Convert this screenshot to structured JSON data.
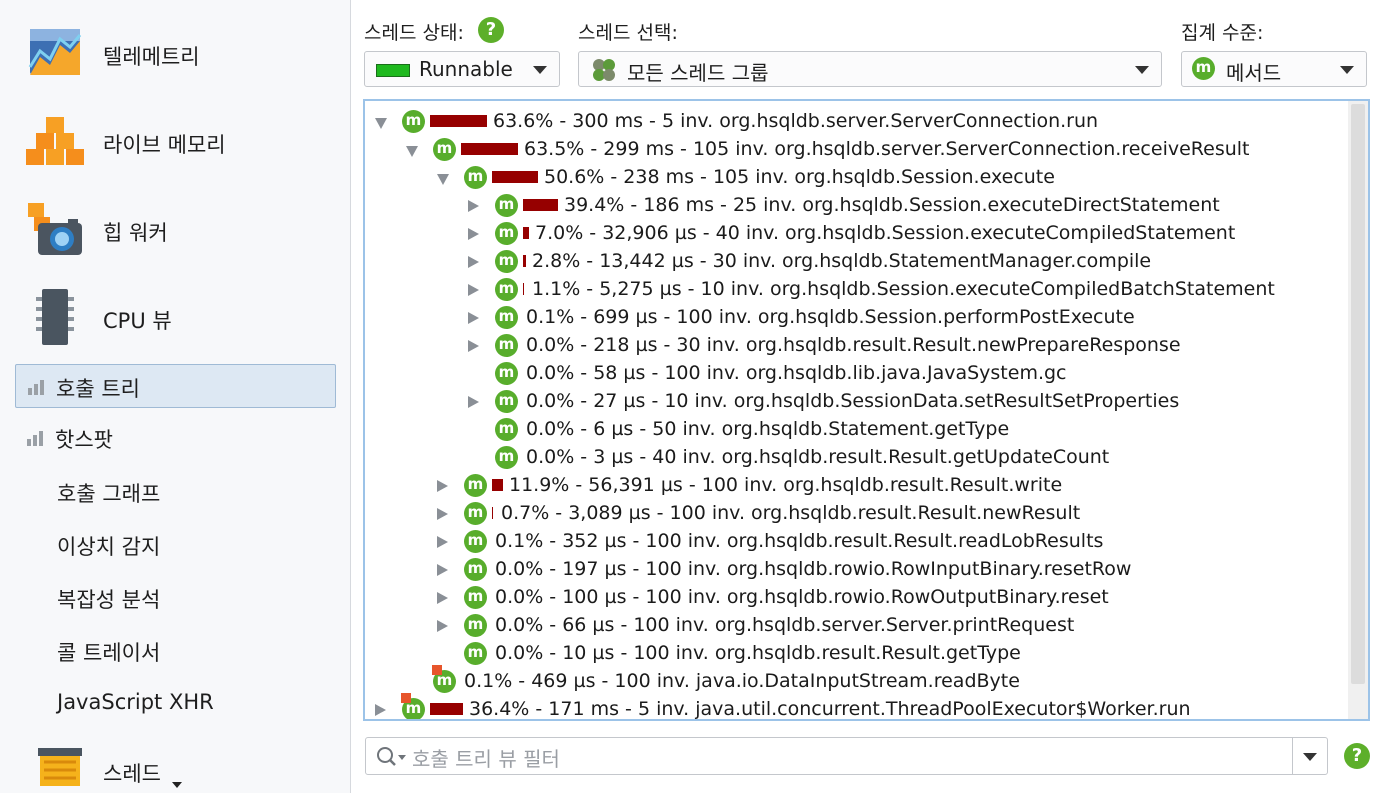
{
  "sidebar": {
    "big_items": [
      {
        "label": "텔레메트리",
        "icon": "telemetry-icon"
      },
      {
        "label": "라이브 메모리",
        "icon": "live-memory-icon"
      },
      {
        "label": "힙 워커",
        "icon": "heap-walker-icon"
      },
      {
        "label": "CPU 뷰",
        "icon": "cpu-views-icon"
      }
    ],
    "sub_items": [
      {
        "label": "호출 트리",
        "selected": true
      },
      {
        "label": "핫스팟",
        "selected": false
      }
    ],
    "leaf_items": [
      "호출 그래프",
      "이상치 감지",
      "복잡성 분석",
      "콜 트레이서",
      "JavaScript XHR"
    ],
    "threads_label": "스레드"
  },
  "toolbar": {
    "thread_status_label": "스레드 상태:",
    "thread_status_value": "Runnable",
    "thread_status_color": "#1fb91f",
    "thread_select_label": "스레드 선택:",
    "thread_select_value": "모든 스레드 그룹",
    "aggregation_label": "집계 수준:",
    "aggregation_value": "메서드",
    "help_glyph": "?"
  },
  "tree": {
    "accent_bar_color": "#960000",
    "node_icon_letter": "m",
    "rows": [
      {
        "depth": 0,
        "toggle": "open",
        "bar_pct": 63.6,
        "flag": false,
        "text": "63.6% - 300 ms - 5 inv. org.hsqldb.server.ServerConnection.run"
      },
      {
        "depth": 1,
        "toggle": "open",
        "bar_pct": 63.5,
        "flag": false,
        "text": "63.5% - 299 ms - 105 inv. org.hsqldb.server.ServerConnection.receiveResult"
      },
      {
        "depth": 2,
        "toggle": "open",
        "bar_pct": 50.6,
        "flag": false,
        "text": "50.6% - 238 ms - 105 inv. org.hsqldb.Session.execute"
      },
      {
        "depth": 3,
        "toggle": "closed",
        "bar_pct": 39.4,
        "flag": false,
        "text": "39.4% - 186 ms - 25 inv. org.hsqldb.Session.executeDirectStatement"
      },
      {
        "depth": 3,
        "toggle": "closed",
        "bar_pct": 7.0,
        "flag": false,
        "text": "7.0% - 32,906 µs - 40 inv. org.hsqldb.Session.executeCompiledStatement"
      },
      {
        "depth": 3,
        "toggle": "closed",
        "bar_pct": 2.8,
        "flag": false,
        "text": "2.8% - 13,442 µs - 30 inv. org.hsqldb.StatementManager.compile"
      },
      {
        "depth": 3,
        "toggle": "closed",
        "bar_pct": 1.1,
        "flag": false,
        "text": "1.1% - 5,275 µs - 10 inv. org.hsqldb.Session.executeCompiledBatchStatement"
      },
      {
        "depth": 3,
        "toggle": "closed",
        "bar_pct": 0.1,
        "flag": false,
        "text": "0.1% - 699 µs - 100 inv. org.hsqldb.Session.performPostExecute"
      },
      {
        "depth": 3,
        "toggle": "closed",
        "bar_pct": 0.0,
        "flag": false,
        "text": "0.0% - 218 µs - 30 inv. org.hsqldb.result.Result.newPrepareResponse"
      },
      {
        "depth": 3,
        "toggle": "none",
        "bar_pct": 0.0,
        "flag": false,
        "text": "0.0% - 58 µs - 100 inv. org.hsqldb.lib.java.JavaSystem.gc"
      },
      {
        "depth": 3,
        "toggle": "closed",
        "bar_pct": 0.0,
        "flag": false,
        "text": "0.0% - 27 µs - 10 inv. org.hsqldb.SessionData.setResultSetProperties"
      },
      {
        "depth": 3,
        "toggle": "none",
        "bar_pct": 0.0,
        "flag": false,
        "text": "0.0% - 6 µs - 50 inv. org.hsqldb.Statement.getType"
      },
      {
        "depth": 3,
        "toggle": "none",
        "bar_pct": 0.0,
        "flag": false,
        "text": "0.0% - 3 µs - 40 inv. org.hsqldb.result.Result.getUpdateCount"
      },
      {
        "depth": 2,
        "toggle": "closed",
        "bar_pct": 11.9,
        "flag": false,
        "text": "11.9% - 56,391 µs - 100 inv. org.hsqldb.result.Result.write"
      },
      {
        "depth": 2,
        "toggle": "closed",
        "bar_pct": 0.7,
        "flag": false,
        "text": "0.7% - 3,089 µs - 100 inv. org.hsqldb.result.Result.newResult"
      },
      {
        "depth": 2,
        "toggle": "closed",
        "bar_pct": 0.1,
        "flag": false,
        "text": "0.1% - 352 µs - 100 inv. org.hsqldb.result.Result.readLobResults"
      },
      {
        "depth": 2,
        "toggle": "closed",
        "bar_pct": 0.0,
        "flag": false,
        "text": "0.0% - 197 µs - 100 inv. org.hsqldb.rowio.RowInputBinary.resetRow"
      },
      {
        "depth": 2,
        "toggle": "closed",
        "bar_pct": 0.0,
        "flag": false,
        "text": "0.0% - 100 µs - 100 inv. org.hsqldb.rowio.RowOutputBinary.reset"
      },
      {
        "depth": 2,
        "toggle": "closed",
        "bar_pct": 0.0,
        "flag": false,
        "text": "0.0% - 66 µs - 100 inv. org.hsqldb.server.Server.printRequest"
      },
      {
        "depth": 2,
        "toggle": "none",
        "bar_pct": 0.0,
        "flag": false,
        "text": "0.0% - 10 µs - 100 inv. org.hsqldb.result.Result.getType"
      },
      {
        "depth": 1,
        "toggle": "none",
        "bar_pct": 0.1,
        "flag": true,
        "text": "0.1% - 469 µs - 100 inv. java.io.DataInputStream.readByte"
      },
      {
        "depth": 0,
        "toggle": "closed",
        "bar_pct": 36.4,
        "flag": true,
        "text": "36.4% - 171 ms - 5 inv. java.util.concurrent.ThreadPoolExecutor$Worker.run"
      }
    ]
  },
  "filter": {
    "placeholder": "호출 트리 뷰 필터",
    "help_glyph": "?"
  }
}
